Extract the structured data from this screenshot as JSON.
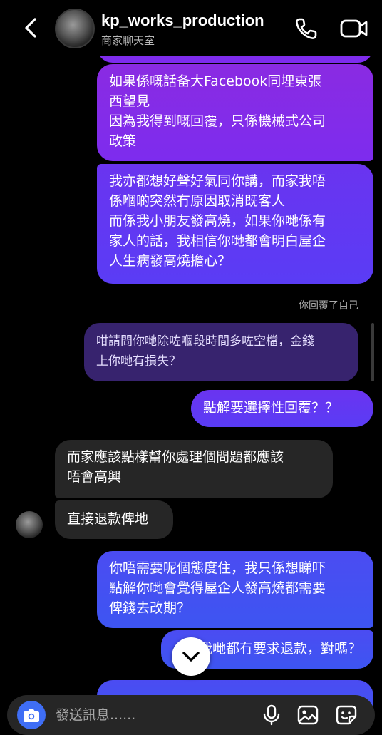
{
  "header": {
    "name": "kp_works_production",
    "subtitle": "商家聊天室"
  },
  "messages": [
    {
      "id": "m1",
      "text": "如果係嘅話备大Facebook同埋東張\n西望見\n因為我得到嘅回覆，只係機械式公司\n政策"
    },
    {
      "id": "m2",
      "text": "我亦都想好聲好氣同你講，而家我唔\n係嗰啲突然冇原因取消既客人\n而係我小朋友發高燒，如果你哋係有\n家人的話，我相信你哋都會明白屋企\n人生病發高燒擔心？"
    },
    {
      "id": "m3_note",
      "text": "你回覆了自己"
    },
    {
      "id": "m3_quoted",
      "text": "咁請問你哋除咗嗰段時間多咗空檔，金錢\n上你哋有損失？"
    },
    {
      "id": "m4",
      "text": "點解要選擇性回覆？？"
    },
    {
      "id": "m5",
      "text": "而家應該點樣幫你處理個問題都應該\n唔會高興"
    },
    {
      "id": "m6",
      "text": "直接退款俾地"
    },
    {
      "id": "m7",
      "text": "你唔需要呢個態度住，我只係想睇吓\n點解你哋會覺得屋企人發高燒都需要\n俾錢去改期？"
    },
    {
      "id": "m8",
      "text": "我哋都冇要求退款，對嗎？"
    },
    {
      "id": "m9",
      "text": ""
    }
  ],
  "composer": {
    "placeholder": "發送訊息......"
  }
}
